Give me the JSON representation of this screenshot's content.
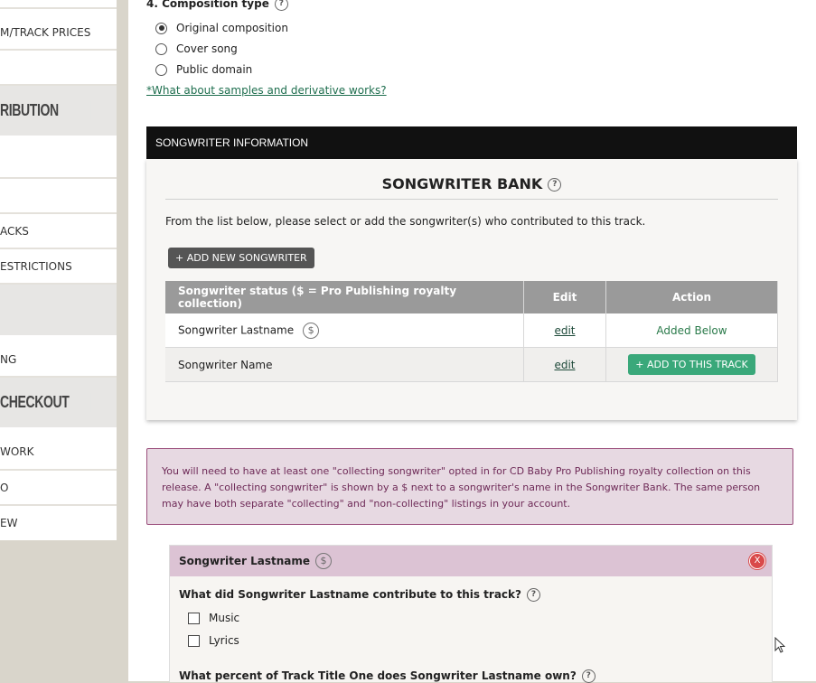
{
  "sidebar": {
    "items": [
      {
        "label": "M/TRACK PRICES",
        "type": "link"
      },
      {
        "label": "",
        "type": "link"
      },
      {
        "label": "RIBUTION",
        "type": "header"
      },
      {
        "label": "",
        "type": "link"
      },
      {
        "label": "",
        "type": "link"
      },
      {
        "label": "ACKS",
        "type": "link"
      },
      {
        "label": "ESTRICTIONS",
        "type": "link"
      },
      {
        "label": "",
        "type": "header"
      },
      {
        "label": "NG",
        "type": "link"
      },
      {
        "label": "CHECKOUT",
        "type": "header"
      },
      {
        "label": "WORK",
        "type": "link"
      },
      {
        "label": "O",
        "type": "link"
      },
      {
        "label": "EW",
        "type": "link"
      }
    ]
  },
  "composition": {
    "label": "4. Composition type",
    "options": [
      "Original composition",
      "Cover song",
      "Public domain"
    ],
    "selected_index": 0,
    "samples_link": "*What about samples and derivative works?"
  },
  "songwriter_section": {
    "header": "SONGWRITER INFORMATION",
    "bank_title": "SONGWRITER BANK",
    "description": "From the list below, please select or add the songwriter(s) who contributed to this track.",
    "add_button": "+ ADD NEW SONGWRITER",
    "table": {
      "columns": [
        "Songwriter status ($ = Pro Publishing royalty collection)",
        "Edit",
        "Action"
      ],
      "rows": [
        {
          "name": "Songwriter Lastname",
          "collecting": true,
          "edit": "edit",
          "action": "Added Below",
          "action_type": "text"
        },
        {
          "name": "Songwriter Name",
          "collecting": false,
          "edit": "edit",
          "action": "+ ADD TO THIS TRACK",
          "action_type": "button"
        }
      ]
    }
  },
  "notice": {
    "text": "You will need to have at least one \"collecting songwriter\" opted in for CD Baby Pro Publishing royalty collection on this release. A \"collecting songwriter\" is shown by a $ next to a songwriter's name in the Songwriter Bank. The same person may have both separate \"collecting\" and \"non-collecting\" listings in your account."
  },
  "songwriter_card": {
    "name": "Songwriter Lastname",
    "close": "X",
    "contribute_question": "What did Songwriter Lastname contribute to this track?",
    "options": [
      "Music",
      "Lyrics"
    ],
    "percent_question": "What percent of Track Title One does Songwriter Lastname own?"
  },
  "icons": {
    "help": "?",
    "dollar": "$"
  },
  "colors": {
    "accent_green": "#3aa87a",
    "notice_border": "#9b4f7c",
    "close_red": "#d94a4a"
  }
}
